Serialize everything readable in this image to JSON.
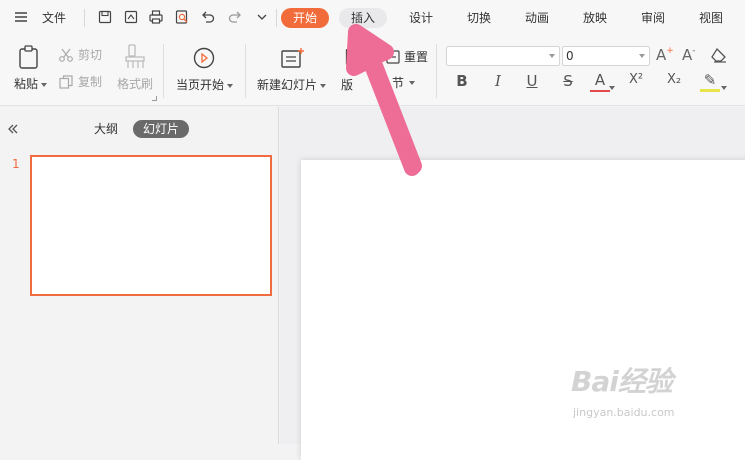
{
  "topbar": {
    "menu_icon": "hamburger-icon",
    "file_label": "文件",
    "quick_icons": [
      "save-icon",
      "export-pdf-icon",
      "print-icon",
      "print-preview-icon",
      "undo-icon",
      "redo-icon",
      "more-chevron-icon"
    ],
    "tabs": [
      {
        "label": "开始",
        "state": "active"
      },
      {
        "label": "插入",
        "state": "hover"
      },
      {
        "label": "设计",
        "state": "normal"
      },
      {
        "label": "切换",
        "state": "normal"
      },
      {
        "label": "动画",
        "state": "normal"
      },
      {
        "label": "放映",
        "state": "normal"
      },
      {
        "label": "审阅",
        "state": "normal"
      },
      {
        "label": "视图",
        "state": "normal"
      }
    ]
  },
  "ribbon": {
    "paste_label": "粘贴",
    "cut_label": "剪切",
    "copy_label": "复制",
    "format_painter_label": "格式刷",
    "from_current_label": "当页开始",
    "new_slide_label": "新建幻灯片",
    "layout_label": "版",
    "reset_label": "重置",
    "section_label": "节",
    "font_name_value": "",
    "font_size_value": "0",
    "format_buttons": [
      {
        "icon": "bold-icon",
        "glyph": "B"
      },
      {
        "icon": "italic-icon",
        "glyph": "I"
      },
      {
        "icon": "underline-icon",
        "glyph": "U"
      },
      {
        "icon": "strikethrough-icon",
        "glyph": "S"
      },
      {
        "icon": "font-color-icon",
        "glyph": "A"
      },
      {
        "icon": "superscript-icon",
        "glyph": "X²"
      },
      {
        "icon": "subscript-icon",
        "glyph": "X₂"
      },
      {
        "icon": "highlight-icon",
        "glyph": "✎"
      }
    ]
  },
  "left_panel": {
    "outline_tab": "大纲",
    "slides_tab": "幻灯片",
    "slide_number": "1"
  },
  "watermark": {
    "main": "Bai经验",
    "sub": "jingyan.baidu.com"
  },
  "colors": {
    "accent": "#f26b3a",
    "arrow": "#ee6d96"
  }
}
